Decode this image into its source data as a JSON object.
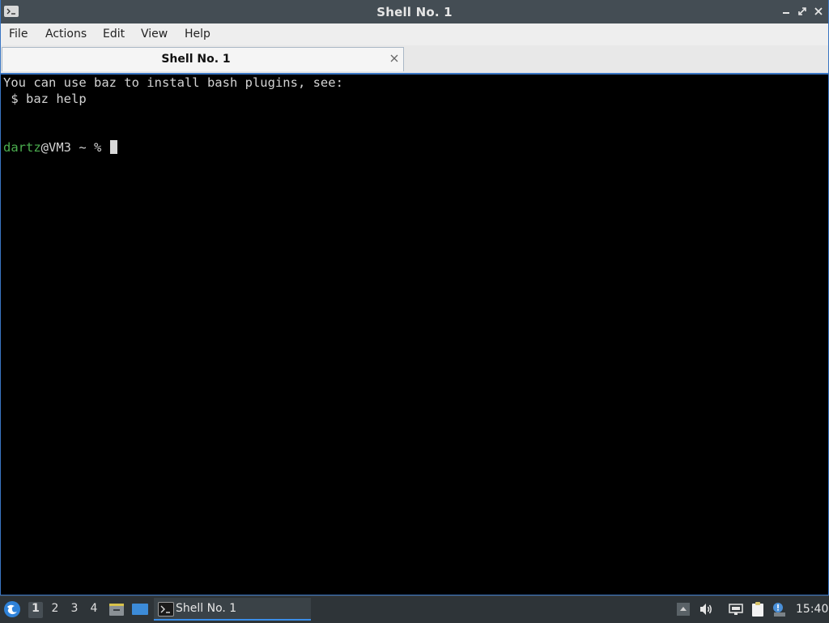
{
  "window": {
    "title": "Shell No. 1"
  },
  "menu": {
    "items": [
      "File",
      "Actions",
      "Edit",
      "View",
      "Help"
    ]
  },
  "tabs": [
    {
      "label": "Shell No. 1"
    }
  ],
  "terminal": {
    "line1": "You can use baz to install bash plugins, see:",
    "line2": " $ baz help",
    "prompt_user": "dartz",
    "prompt_rest": "@VM3 ~ % "
  },
  "taskbar": {
    "workspaces": [
      "1",
      "2",
      "3",
      "4"
    ],
    "active_workspace": "1",
    "task_label": "Shell No. 1",
    "clock": "15:40"
  },
  "colors": {
    "accent": "#3a76c4",
    "titlebar": "#444d54",
    "prompt_user": "#4bae4f"
  }
}
